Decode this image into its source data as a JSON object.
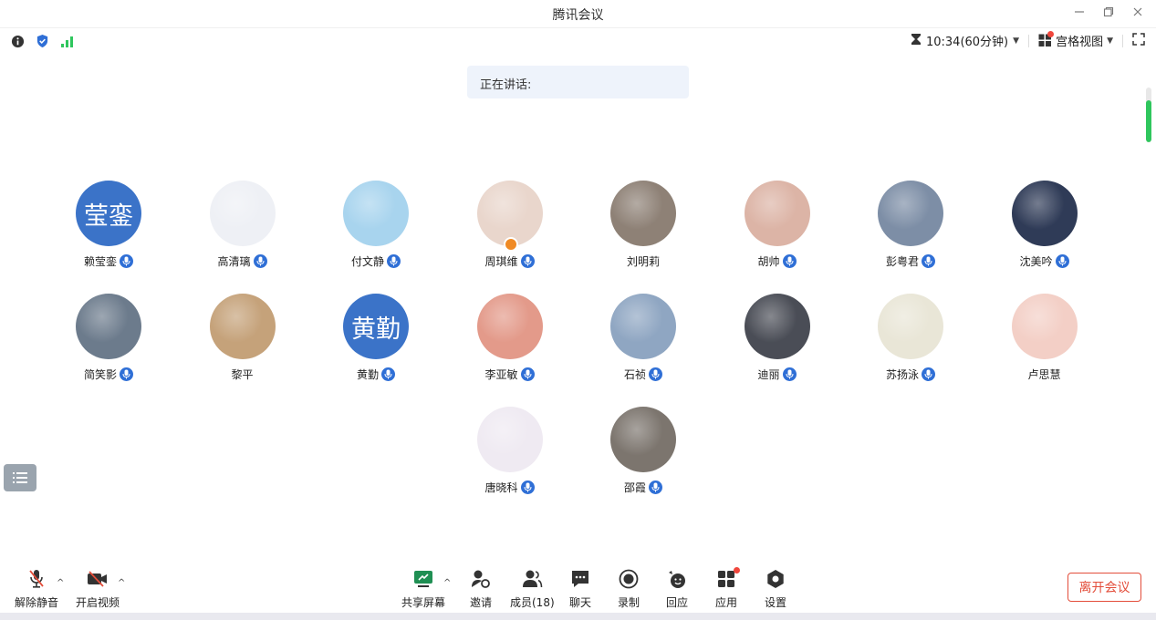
{
  "window": {
    "title": "腾讯会议"
  },
  "status": {
    "timer": "10:34(60分钟)",
    "view_label": "宫格视图"
  },
  "speaking": {
    "label": "正在讲话:"
  },
  "participants": [
    {
      "name": "赖莹銮",
      "avatar_text": "莹銮",
      "avatar_color": "#3b73c8",
      "mic": true
    },
    {
      "name": "高清璃",
      "avatar_color": "#eef0f5",
      "mic": true
    },
    {
      "name": "付文静",
      "avatar_color": "#a8d4ee",
      "mic": true
    },
    {
      "name": "周琪维",
      "avatar_color": "#e9d6cc",
      "mic": true,
      "host": true
    },
    {
      "name": "刘明莉",
      "avatar_color": "#8e8176",
      "mic": false
    },
    {
      "name": "胡帅",
      "avatar_color": "#dcb4a6",
      "mic": true
    },
    {
      "name": "彭粤君",
      "avatar_color": "#7d8ea6",
      "mic": true
    },
    {
      "name": "沈美吟",
      "avatar_color": "#2f3b57",
      "mic": true
    },
    {
      "name": "简笑影",
      "avatar_color": "#6c7b8c",
      "mic": true
    },
    {
      "name": "黎平",
      "avatar_color": "#c5a27a",
      "mic": false
    },
    {
      "name": "黄勤",
      "avatar_text": "黄勤",
      "avatar_color": "#3b73c8",
      "mic": true
    },
    {
      "name": "李亚敏",
      "avatar_color": "#e39a8a",
      "mic": true
    },
    {
      "name": "石祯",
      "avatar_color": "#8fa6c2",
      "mic": true
    },
    {
      "name": "迪丽",
      "avatar_color": "#4a4d56",
      "mic": true
    },
    {
      "name": "苏扬泳",
      "avatar_color": "#e9e6d7",
      "mic": true
    },
    {
      "name": "卢思慧",
      "avatar_color": "#f3cfc6",
      "mic": false
    },
    {
      "name": "唐晓科",
      "avatar_color": "#efeaf2",
      "mic": true
    },
    {
      "name": "邵霞",
      "avatar_color": "#7c756e",
      "mic": true
    }
  ],
  "toolbar": {
    "unmute": "解除静音",
    "start_video": "开启视频",
    "share_screen": "共享屏幕",
    "invite": "邀请",
    "members": "成员(18)",
    "chat": "聊天",
    "record": "录制",
    "reaction": "回应",
    "apps": "应用",
    "settings": "设置",
    "leave": "离开会议"
  },
  "colors": {
    "accent": "#2f6fd6",
    "leave": "#e34d3a",
    "signal": "#2fc65d"
  }
}
